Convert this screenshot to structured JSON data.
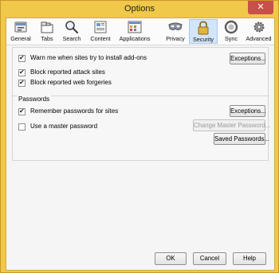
{
  "window": {
    "title": "Options",
    "close_glyph": "✕"
  },
  "toolbar": {
    "tabs": [
      {
        "label": "General"
      },
      {
        "label": "Tabs"
      },
      {
        "label": "Search"
      },
      {
        "label": "Content"
      },
      {
        "label": "Applications"
      },
      {
        "label": "Privacy"
      },
      {
        "label": "Security"
      },
      {
        "label": "Sync"
      },
      {
        "label": "Advanced"
      }
    ],
    "active": "Security"
  },
  "addons": {
    "warn_label": "Warn me when sites try to install add-ons",
    "warn_checked": true,
    "exceptions_button": "Exceptions..."
  },
  "attacks": {
    "block_attack_label": "Block reported attack sites",
    "block_attack_checked": true,
    "block_forgery_label": "Block reported web forgeries",
    "block_forgery_checked": true
  },
  "passwords": {
    "legend": "Passwords",
    "remember_label": "Remember passwords for sites",
    "remember_checked": true,
    "exceptions_button": "Exceptions...",
    "master_label": "Use a master password",
    "master_checked": false,
    "change_master_button": "Change Master Password...",
    "saved_button": "Saved Passwords..."
  },
  "footer": {
    "ok": "OK",
    "cancel": "Cancel",
    "help": "Help"
  },
  "colors": {
    "frame": "#f0c84a",
    "close": "#c7504a",
    "active_tab": "#d3e5f8"
  }
}
